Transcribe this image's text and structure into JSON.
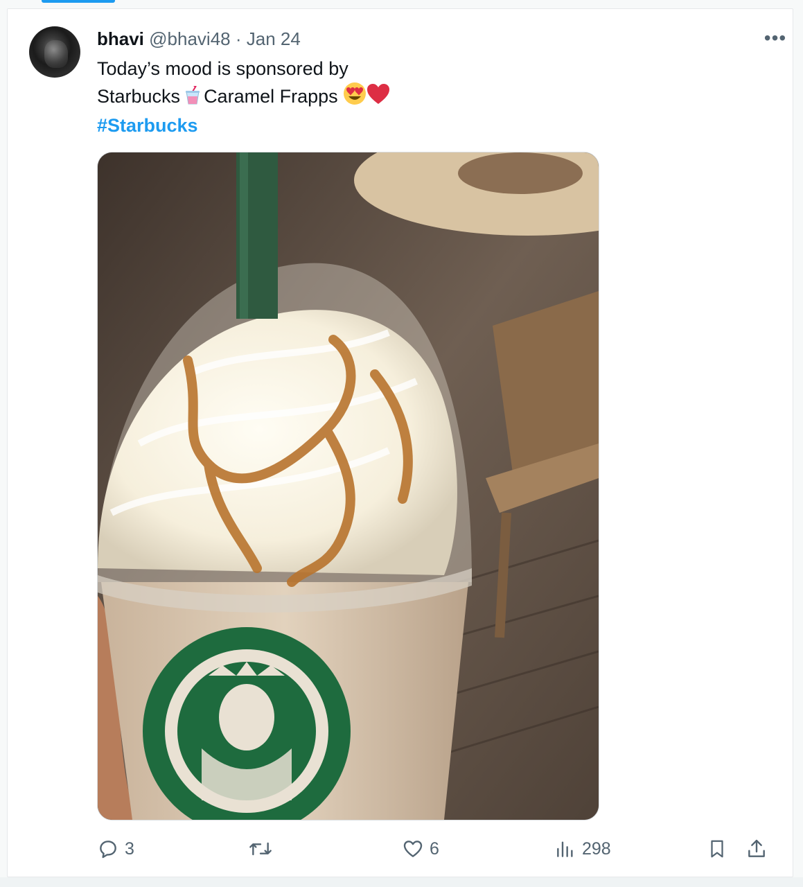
{
  "tweet": {
    "display_name": "bhavi",
    "handle": "@bhavi48",
    "separator": "·",
    "date": "Jan 24",
    "more_label": "•••",
    "text_line1": "Today’s mood is sponsored by",
    "text_line2_a": "Starbucks",
    "text_line2_b": "Caramel Frapps",
    "emoji_heart_eyes": "😍",
    "emoji_heart": "❤",
    "hashtag": "#Starbucks"
  },
  "actions": {
    "reply_count": "3",
    "retweet_count": "",
    "like_count": "6",
    "views_count": "298"
  },
  "icons": {
    "reply": "speech-bubble-icon",
    "retweet": "retweet-icon",
    "like": "heart-icon",
    "views": "bar-chart-icon",
    "bookmark": "bookmark-icon",
    "share": "share-icon",
    "more": "more-dots-icon"
  },
  "colors": {
    "accent": "#1d9bf0",
    "text": "#0f1419",
    "muted": "#536471"
  }
}
